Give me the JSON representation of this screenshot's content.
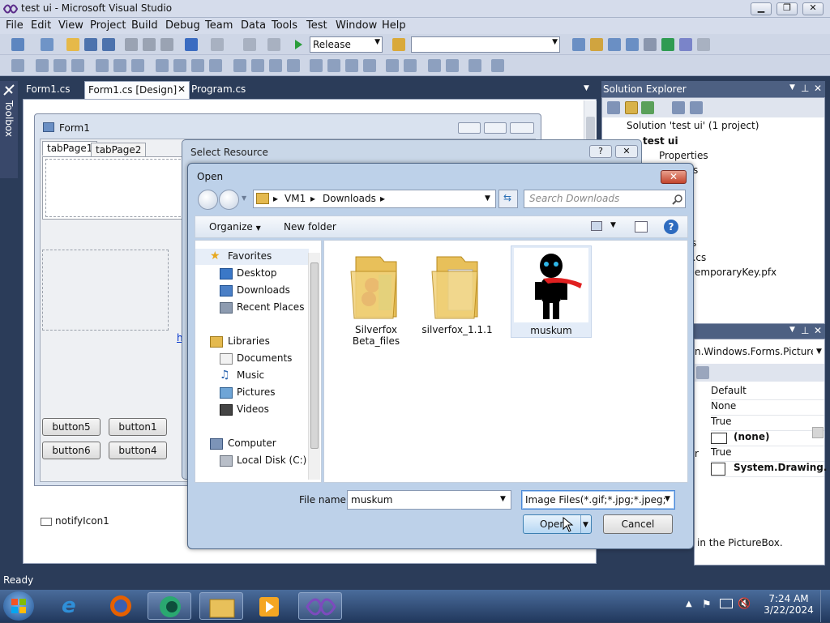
{
  "window": {
    "title": "test ui - Microsoft Visual Studio"
  },
  "menu": [
    "File",
    "Edit",
    "View",
    "Project",
    "Build",
    "Debug",
    "Team",
    "Data",
    "Tools",
    "Test",
    "Window",
    "Help"
  ],
  "toolbar": {
    "config": "Release",
    "platform": ""
  },
  "toolbox": {
    "label": "Toolbox"
  },
  "doc_tabs": [
    "Form1.cs",
    "Form1.cs [Design]",
    "Program.cs"
  ],
  "form1": {
    "title": "Form1",
    "tabs": [
      "tabPage1",
      "tabPage2"
    ],
    "buttons": [
      "button5",
      "button1",
      "button6",
      "button4"
    ],
    "link_fragment": "h"
  },
  "tray": {
    "component": "notifyIcon1"
  },
  "solution_explorer": {
    "title": "Solution Explorer",
    "items": [
      "Solution 'test ui' (1 project)",
      "test ui",
      "Properties",
      "ces",
      "es",
      "s",
      "n.cs",
      "emporaryKey.pfx"
    ]
  },
  "properties": {
    "object_fragment": "n.Windows.Forms.PictureBo",
    "values": [
      "Default",
      "None",
      "True",
      "(none)",
      "True",
      "System.Drawing."
    ],
    "name_fragment": "r",
    "description": "in the PictureBox."
  },
  "select_resource": {
    "title": "Select Resource",
    "help": "?"
  },
  "open_dialog": {
    "title": "Open",
    "breadcrumb": [
      "VM1",
      "Downloads"
    ],
    "search_placeholder": "Search Downloads",
    "organize": "Organize",
    "new_folder": "New folder",
    "nav": {
      "favorites": "Favorites",
      "favorites_items": [
        "Desktop",
        "Downloads",
        "Recent Places"
      ],
      "libraries": "Libraries",
      "libraries_items": [
        "Documents",
        "Music",
        "Pictures",
        "Videos"
      ],
      "computer": "Computer",
      "computer_items": [
        "Local Disk (C:)"
      ]
    },
    "files": [
      {
        "name_line1": "Silverfox",
        "name_line2": "Beta_files"
      },
      {
        "name_line1": "silverfox_1.1.1",
        "name_line2": ""
      },
      {
        "name_line1": "muskum",
        "name_line2": ""
      }
    ],
    "file_name_label": "File name:",
    "file_name_value": "muskum",
    "file_type": "Image Files(*.gif;*.jpg;*.jpeg;*.b",
    "open_label": "Open",
    "cancel_label": "Cancel"
  },
  "status": {
    "text": "Ready"
  },
  "clock": {
    "time": "7:24 AM",
    "date": "3/22/2024"
  }
}
